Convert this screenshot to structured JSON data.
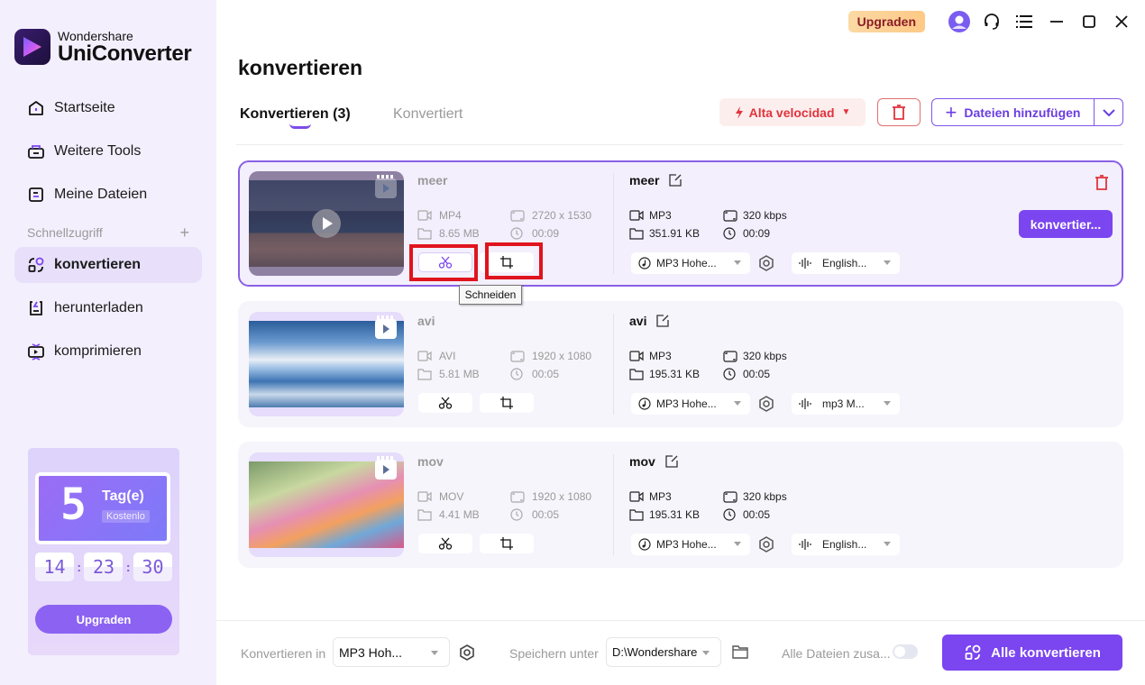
{
  "app": {
    "brand_line1": "Wondershare",
    "brand_line2": "UniConverter"
  },
  "sidebar": {
    "items": [
      {
        "label": "Startseite",
        "icon": "home-icon"
      },
      {
        "label": "Weitere Tools",
        "icon": "toolbox-icon"
      },
      {
        "label": "Meine Dateien",
        "icon": "files-icon"
      }
    ],
    "quick_access_label": "Schnellzugriff",
    "quick_items": [
      {
        "label": "konvertieren",
        "icon": "convert-icon",
        "active": true
      },
      {
        "label": "herunterladen",
        "icon": "download-icon"
      },
      {
        "label": "komprimieren",
        "icon": "compress-icon"
      }
    ],
    "promo": {
      "days_number": "5",
      "days_label": "Tag(e)",
      "free_label": "Kostenlo",
      "timer": [
        "14",
        "23",
        "30"
      ],
      "button_label": "Upgraden"
    }
  },
  "titlebar": {
    "upgrade_label": "Upgraden"
  },
  "main": {
    "title": "konvertieren",
    "tabs": [
      {
        "label": "Konvertieren (3)",
        "active": true
      },
      {
        "label": "Konvertiert",
        "active": false
      }
    ],
    "speed_label": "Alta velocidad",
    "add_files_label": "Dateien hinzufügen",
    "tooltip": "Schneiden",
    "files": [
      {
        "name": "meer",
        "src_format": "MP4",
        "src_size": "8.65 MB",
        "src_resolution": "2720 x 1530",
        "src_duration": "00:09",
        "out_name": "meer",
        "out_format": "MP3",
        "out_size": "351.91 KB",
        "out_bitrate": "320 kbps",
        "out_duration": "00:09",
        "preset": "MP3 Hohe...",
        "audio_track": "English...",
        "convert_label": "konvertier..."
      },
      {
        "name": "avi",
        "src_format": "AVI",
        "src_size": "5.81 MB",
        "src_resolution": "1920 x 1080",
        "src_duration": "00:05",
        "out_name": "avi",
        "out_format": "MP3",
        "out_size": "195.31 KB",
        "out_bitrate": "320 kbps",
        "out_duration": "00:05",
        "preset": "MP3 Hohe...",
        "audio_track": "mp3 M..."
      },
      {
        "name": "mov",
        "src_format": "MOV",
        "src_size": "4.41 MB",
        "src_resolution": "1920 x 1080",
        "src_duration": "00:05",
        "out_name": "mov",
        "out_format": "MP3",
        "out_size": "195.31 KB",
        "out_bitrate": "320 kbps",
        "out_duration": "00:05",
        "preset": "MP3 Hohe...",
        "audio_track": "English..."
      }
    ]
  },
  "bottom": {
    "convert_to_label": "Konvertieren in",
    "convert_to_value": "MP3 Hoh...",
    "save_to_label": "Speichern unter",
    "save_to_value": "D:\\Wondershare",
    "merge_label": "Alle Dateien zusa...",
    "merge_enabled": false,
    "convert_all_label": "Alle konvertieren"
  },
  "colors": {
    "accent": "#7b45f0",
    "danger": "#e0343c",
    "sidebar_bg": "#f3effd",
    "highlight": "#e0141e"
  }
}
